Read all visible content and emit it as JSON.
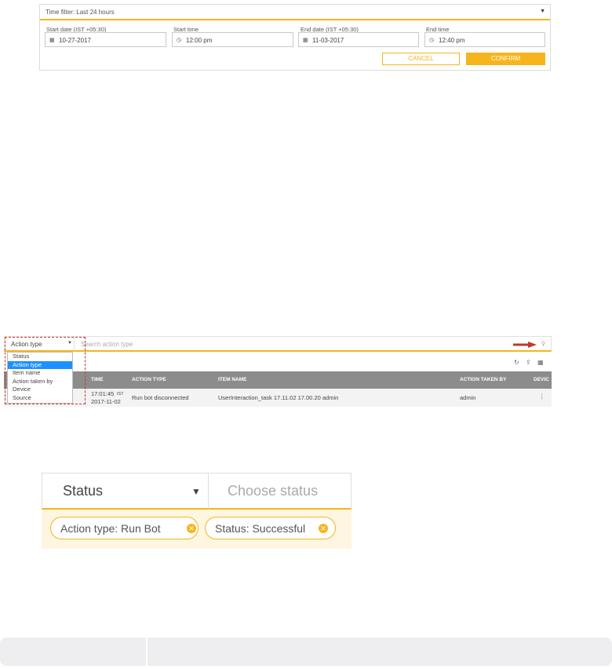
{
  "time_filter": {
    "header": "Time filter: Last 24 hours",
    "start_date_label": "Start date (IST +05:30)",
    "start_date_value": "10-27-2017",
    "start_time_label": "Start time",
    "start_time_value": "12:00 pm",
    "end_date_label": "End date (IST +05:30)",
    "end_date_value": "11-03-2017",
    "end_time_label": "End time",
    "end_time_value": "12:40 pm",
    "cancel_label": "CANCEL",
    "confirm_label": "CONFIRM"
  },
  "audit": {
    "selected_filter": "Action type",
    "search_placeholder": "Search action type",
    "dropdown_options": [
      "Status",
      "Action type",
      "Item name",
      "Action taken by",
      "Device",
      "Source"
    ],
    "columns": [
      "TIME",
      "ACTION TYPE",
      "ITEM NAME",
      "ACTION TAKEN BY",
      "DEVIC"
    ],
    "row": {
      "time": "17:01:45",
      "time_tz": "IST",
      "time_date": "2017-11-02",
      "action_type": "Run bot disconnected",
      "item_name": "UserInteraction_task 17.11.02 17.00.20 admin",
      "action_taken_by": "admin"
    }
  },
  "status_filter": {
    "selected": "Status",
    "placeholder": "Choose status",
    "chips": [
      "Action type:  Run Bot",
      "Status:  Successful"
    ]
  },
  "colors": {
    "accent": "#f6b51c",
    "highlight": "#1e90ff",
    "header_gray": "#8c8c8c",
    "annotation_red": "#c0392b"
  }
}
